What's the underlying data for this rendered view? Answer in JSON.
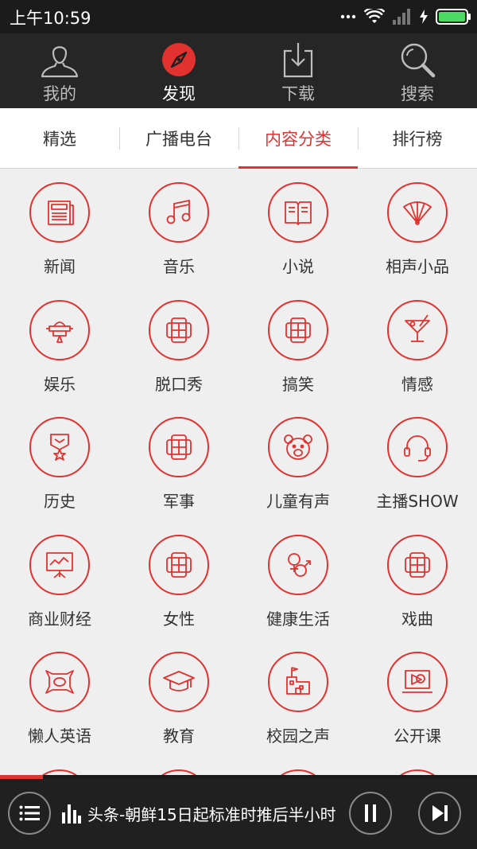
{
  "status": {
    "time": "上午10:59"
  },
  "nav": [
    {
      "label": "我的",
      "icon": "user-icon",
      "active": false
    },
    {
      "label": "发现",
      "icon": "compass-icon",
      "active": true
    },
    {
      "label": "下载",
      "icon": "download-icon",
      "active": false
    },
    {
      "label": "搜索",
      "icon": "search-icon",
      "active": false
    }
  ],
  "tabs": [
    {
      "label": "精选",
      "active": false
    },
    {
      "label": "广播电台",
      "active": false
    },
    {
      "label": "内容分类",
      "active": true
    },
    {
      "label": "排行榜",
      "active": false
    }
  ],
  "categories": [
    {
      "label": "新闻",
      "icon": "newspaper-icon"
    },
    {
      "label": "音乐",
      "icon": "music-note-icon"
    },
    {
      "label": "小说",
      "icon": "book-icon"
    },
    {
      "label": "相声小品",
      "icon": "fan-icon"
    },
    {
      "label": "娱乐",
      "icon": "spaceship-icon"
    },
    {
      "label": "脱口秀",
      "icon": "placeholder-icon"
    },
    {
      "label": "搞笑",
      "icon": "placeholder-icon"
    },
    {
      "label": "情感",
      "icon": "cocktail-icon"
    },
    {
      "label": "历史",
      "icon": "medal-icon"
    },
    {
      "label": "军事",
      "icon": "placeholder-icon"
    },
    {
      "label": "儿童有声",
      "icon": "bear-icon"
    },
    {
      "label": "主播SHOW",
      "icon": "headset-icon"
    },
    {
      "label": "商业财经",
      "icon": "chart-board-icon"
    },
    {
      "label": "女性",
      "icon": "placeholder-icon"
    },
    {
      "label": "健康生活",
      "icon": "gender-icon"
    },
    {
      "label": "戏曲",
      "icon": "placeholder-icon"
    },
    {
      "label": "懒人英语",
      "icon": "pillow-icon"
    },
    {
      "label": "教育",
      "icon": "graduation-cap-icon"
    },
    {
      "label": "校园之声",
      "icon": "school-building-icon"
    },
    {
      "label": "公开课",
      "icon": "video-lesson-icon"
    },
    {
      "label": "",
      "icon": "placeholder-icon"
    },
    {
      "label": "",
      "icon": "placeholder-icon"
    },
    {
      "label": "",
      "icon": "placeholder-icon"
    },
    {
      "label": "",
      "icon": "placeholder-icon"
    }
  ],
  "player": {
    "title": "头条-朝鲜15日起标准时推后半小时",
    "progress": 0.09
  },
  "colors": {
    "accent": "#e2322f",
    "nav_bg": "#262626",
    "status_bg": "#1b1b1b",
    "player_bg": "#202020"
  }
}
